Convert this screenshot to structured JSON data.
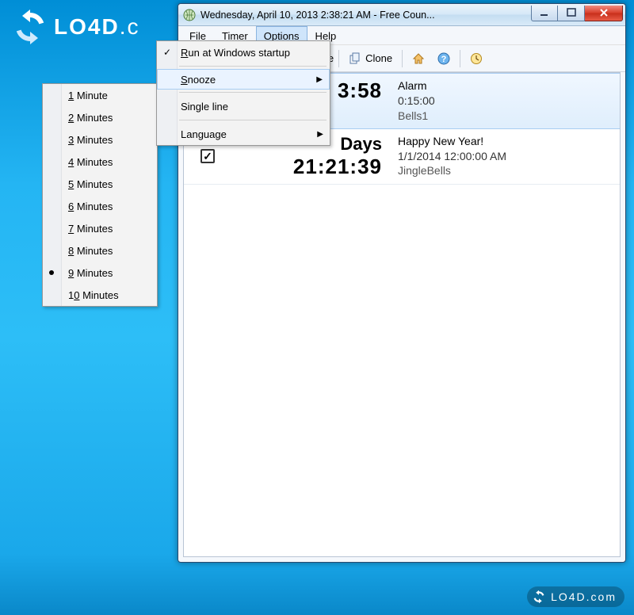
{
  "logo_text": "LO4D.c",
  "watermark_text": "LO4D.com",
  "window": {
    "title": "Wednesday, April 10, 2013 2:38:21 AM - Free Coun..."
  },
  "menubar": {
    "file": "File",
    "timer": "Timer",
    "options": "Options",
    "help": "Help"
  },
  "toolbar": {
    "delete_partial": "ete",
    "clone": "Clone"
  },
  "options_menu": {
    "run_at_startup": "Run at Windows startup",
    "snooze": "Snooze",
    "single_line": "Single line",
    "language": "Language"
  },
  "snooze_menu": {
    "items": [
      {
        "label": "1 Minute"
      },
      {
        "label": "2 Minutes"
      },
      {
        "label": "3 Minutes"
      },
      {
        "label": "4 Minutes"
      },
      {
        "label": "5 Minutes"
      },
      {
        "label": "6 Minutes"
      },
      {
        "label": "7 Minutes"
      },
      {
        "label": "8 Minutes"
      },
      {
        "label": "9 Minutes",
        "selected": true
      },
      {
        "label": "10 Minutes"
      }
    ]
  },
  "timers": [
    {
      "checked": false,
      "days": "",
      "time_display": "3:58",
      "name": "Alarm",
      "schedule": "0:15:00",
      "sound": "Bells1",
      "selected": true
    },
    {
      "checked": true,
      "days": "Days",
      "time_display": "21:21:39",
      "name": "Happy New Year!",
      "schedule": "1/1/2014 12:00:00 AM",
      "sound": "JingleBells",
      "selected": false
    }
  ]
}
